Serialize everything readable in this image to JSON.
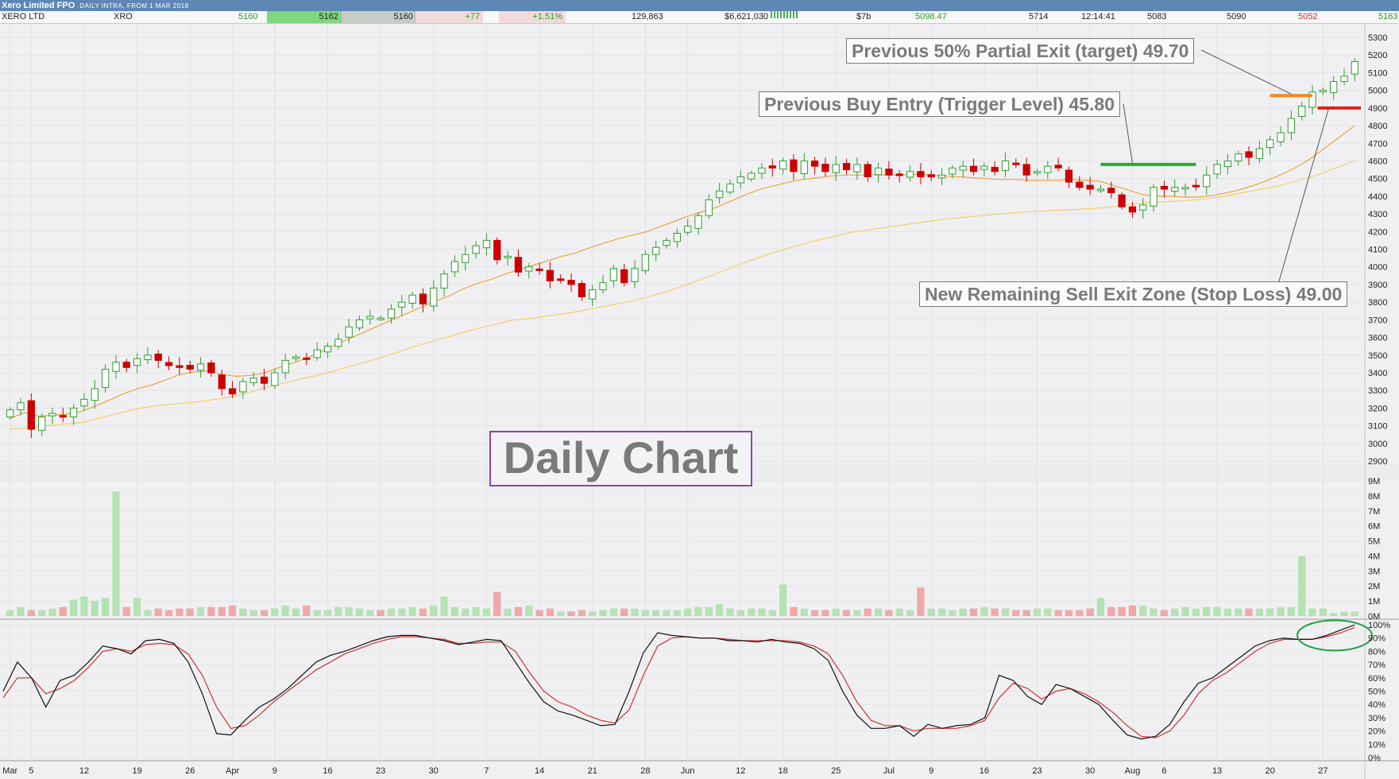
{
  "header": {
    "name": "Xero Limited FPO",
    "subtitle": "DAILY INTRA, FROM 1 MAR 2018"
  },
  "quote": {
    "company": "XERO LTD",
    "code": "XRO",
    "last": "5160",
    "bid": "5162",
    "ask": "5160",
    "change": "+77",
    "change_pct": "+1.51%",
    "volume": "129,863",
    "value": "$6,621,030",
    "mcap": "$7b",
    "vwap": "5098.47",
    "high52": "5714",
    "time": "12:14:41",
    "open": "5083",
    "high": "5090",
    "low": "5052",
    "close": "5163"
  },
  "annotations": {
    "target": "Previous 50% Partial Exit (target) 49.70",
    "entry": "Previous Buy Entry (Trigger Level) 45.80",
    "stop": "New Remaining Sell Exit Zone (Stop Loss) 49.00",
    "watermark": "Daily Chart"
  },
  "colors": {
    "up": "#2f9e2f",
    "down": "#cc0000",
    "ma_fast": "#e8a640",
    "ma_slow": "#f3cf6c",
    "vol_up": "#b5e2b5",
    "vol_down": "#f0a8a8",
    "entry_line": "#2aa832",
    "target_line": "#f08a24",
    "stop_line": "#e02020",
    "stoch_k": "#111111",
    "stoch_d": "#d03030",
    "ellipse": "#22a040"
  },
  "chart_data": {
    "type": "candlestick",
    "title": "Xero Limited FPO",
    "price_axis": {
      "min": 2900,
      "max": 5300,
      "ticks": [
        2900,
        3000,
        3100,
        3200,
        3300,
        3400,
        3500,
        3600,
        3700,
        3800,
        3900,
        4000,
        4100,
        4200,
        4300,
        4400,
        4500,
        4600,
        4700,
        4800,
        4900,
        5000,
        5100,
        5200,
        5300
      ]
    },
    "volume_axis": {
      "min": 0,
      "max": 9000000,
      "tick_labels": [
        "0M",
        "1M",
        "2M",
        "3M",
        "4M",
        "5M",
        "6M",
        "7M",
        "8M",
        "9M"
      ]
    },
    "stoch_axis": {
      "min": 0,
      "max": 100,
      "tick_labels": [
        "0%",
        "10%",
        "20%",
        "30%",
        "40%",
        "50%",
        "60%",
        "70%",
        "80%",
        "90%",
        "100%"
      ]
    },
    "x_labels": [
      "Mar",
      "5",
      "12",
      "19",
      "26",
      "Apr",
      "9",
      "16",
      "23",
      "30",
      "7",
      "14",
      "21",
      "28",
      "Jun",
      "12",
      "18",
      "25",
      "Jul",
      "9",
      "16",
      "23",
      "30",
      "Aug",
      "6",
      "13",
      "20",
      "27"
    ],
    "x_label_bars": [
      0,
      2,
      7,
      12,
      17,
      21,
      25,
      30,
      35,
      40,
      45,
      50,
      55,
      60,
      64,
      69,
      73,
      78,
      83,
      87,
      92,
      97,
      102,
      106,
      109,
      114,
      119,
      124
    ],
    "closes": [
      3190,
      3230,
      3080,
      3150,
      3170,
      3150,
      3200,
      3250,
      3310,
      3420,
      3460,
      3430,
      3480,
      3500,
      3470,
      3440,
      3430,
      3420,
      3450,
      3400,
      3310,
      3280,
      3350,
      3370,
      3340,
      3400,
      3470,
      3490,
      3480,
      3530,
      3550,
      3590,
      3660,
      3700,
      3720,
      3710,
      3760,
      3800,
      3840,
      3790,
      3880,
      3960,
      4030,
      4070,
      4120,
      4150,
      4040,
      4060,
      3970,
      4000,
      3980,
      3920,
      3930,
      3900,
      3830,
      3870,
      3910,
      3990,
      3910,
      3990,
      4070,
      4110,
      4150,
      4190,
      4230,
      4290,
      4380,
      4430,
      4470,
      4510,
      4530,
      4560,
      4560,
      4600,
      4540,
      4600,
      4570,
      4540,
      4580,
      4550,
      4580,
      4510,
      4560,
      4520,
      4520,
      4540,
      4510,
      4510,
      4520,
      4560,
      4570,
      4540,
      4570,
      4540,
      4600,
      4580,
      4520,
      4540,
      4570,
      4560,
      4480,
      4450,
      4440,
      4440,
      4420,
      4340,
      4310,
      4350,
      4450,
      4440,
      4450,
      4450,
      4460,
      4520,
      4580,
      4600,
      4640,
      4620,
      4670,
      4720,
      4760,
      4840,
      4910,
      4990,
      5000,
      5050,
      5080,
      5163
    ],
    "ma_fast": [
      3140,
      3175,
      3155,
      3160,
      3165,
      3180,
      3210,
      3245,
      3280,
      3310,
      3330,
      3360,
      3390,
      3405,
      3410,
      3390,
      3380,
      3385,
      3400,
      3430,
      3455,
      3485,
      3520,
      3560,
      3595,
      3630,
      3665,
      3700,
      3735,
      3770,
      3805,
      3835,
      3875,
      3905,
      3930,
      3960,
      3985,
      4010,
      4035,
      4060,
      4080,
      4110,
      4135,
      4160,
      4180,
      4200,
      4230,
      4260,
      4290,
      4315,
      4340,
      4375,
      4410,
      4440,
      4460,
      4480,
      4495,
      4505,
      4515,
      4520,
      4520,
      4520,
      4520,
      4520,
      4525,
      4520,
      4515,
      4510,
      4505,
      4500,
      4495,
      4495,
      4490,
      4490,
      4490,
      4495,
      4490,
      4485,
      4460,
      4435,
      4410,
      4400,
      4400,
      4395,
      4395,
      4405,
      4420,
      4440,
      4465,
      4495,
      4530,
      4570,
      4620,
      4680,
      4740,
      4800
    ],
    "ma_slow": [
      3080,
      3090,
      3100,
      3110,
      3120,
      3150,
      3175,
      3200,
      3215,
      3225,
      3235,
      3250,
      3265,
      3295,
      3325,
      3350,
      3375,
      3400,
      3430,
      3460,
      3490,
      3525,
      3560,
      3590,
      3620,
      3650,
      3675,
      3700,
      3710,
      3725,
      3740,
      3760,
      3780,
      3800,
      3825,
      3855,
      3890,
      3930,
      3970,
      4010,
      4050,
      4085,
      4115,
      4145,
      4170,
      4195,
      4210,
      4225,
      4240,
      4255,
      4270,
      4280,
      4290,
      4300,
      4310,
      4315,
      4320,
      4325,
      4330,
      4340,
      4355,
      4365,
      4370,
      4375,
      4385,
      4400,
      4420,
      4440,
      4460,
      4490,
      4520,
      4560,
      4600
    ],
    "volume": [
      0.4,
      0.6,
      0.4,
      0.4,
      0.5,
      0.6,
      1.1,
      1.3,
      1.0,
      1.2,
      8.3,
      0.6,
      1.2,
      0.4,
      0.5,
      0.4,
      0.5,
      0.5,
      0.6,
      0.6,
      0.6,
      0.7,
      0.5,
      0.4,
      0.4,
      0.5,
      0.7,
      0.5,
      0.7,
      0.4,
      0.4,
      0.6,
      0.6,
      0.5,
      0.4,
      0.4,
      0.5,
      0.5,
      0.6,
      0.5,
      0.7,
      1.3,
      0.6,
      0.5,
      0.6,
      0.5,
      1.6,
      0.5,
      0.6,
      0.7,
      0.4,
      0.5,
      0.3,
      0.3,
      0.4,
      0.3,
      0.4,
      0.5,
      0.5,
      0.5,
      0.4,
      0.4,
      0.4,
      0.4,
      0.5,
      0.6,
      0.6,
      0.8,
      0.5,
      0.4,
      0.5,
      0.5,
      0.4,
      2.1,
      0.6,
      0.5,
      0.4,
      0.4,
      0.5,
      0.4,
      0.4,
      0.5,
      0.5,
      0.4,
      0.5,
      0.4,
      1.9,
      0.5,
      0.5,
      0.4,
      0.5,
      0.5,
      0.6,
      0.5,
      0.5,
      0.4,
      0.4,
      0.5,
      0.5,
      0.4,
      0.4,
      0.4,
      0.5,
      1.2,
      0.6,
      0.6,
      0.7,
      0.7,
      0.5,
      0.4,
      0.5,
      0.6,
      0.5,
      0.6,
      0.6,
      0.5,
      0.5,
      0.5,
      0.5,
      0.5,
      0.6,
      0.6,
      4.0,
      0.5,
      0.5,
      0.2
    ],
    "stoch_k": [
      50,
      72,
      60,
      38,
      58,
      62,
      72,
      84,
      82,
      78,
      88,
      89,
      86,
      72,
      48,
      18,
      17,
      28,
      38,
      44,
      52,
      62,
      72,
      77,
      80,
      84,
      88,
      91,
      92,
      92,
      90,
      88,
      85,
      87,
      89,
      88,
      72,
      56,
      42,
      35,
      32,
      28,
      24,
      25,
      50,
      79,
      94,
      92,
      91,
      90,
      90,
      88,
      88,
      87,
      89,
      87,
      86,
      82,
      73,
      50,
      32,
      22,
      22,
      24,
      16,
      25,
      22,
      24,
      25,
      30,
      62,
      58,
      46,
      40,
      55,
      52,
      46,
      40,
      28,
      17,
      14,
      16,
      25,
      42,
      56,
      60,
      68,
      76,
      84,
      88,
      90,
      89,
      89,
      92,
      96,
      100
    ],
    "stoch_d": [
      45,
      60,
      60,
      48,
      52,
      58,
      68,
      80,
      82,
      80,
      85,
      86,
      85,
      78,
      62,
      38,
      22,
      24,
      32,
      42,
      50,
      58,
      66,
      72,
      78,
      82,
      86,
      89,
      91,
      91,
      90,
      89,
      86,
      86,
      87,
      87,
      80,
      64,
      50,
      42,
      38,
      32,
      28,
      26,
      36,
      62,
      84,
      90,
      91,
      90,
      90,
      89,
      88,
      88,
      88,
      88,
      87,
      84,
      78,
      62,
      42,
      28,
      24,
      24,
      20,
      22,
      22,
      22,
      24,
      28,
      45,
      56,
      52,
      44,
      50,
      52,
      48,
      42,
      34,
      24,
      16,
      15,
      20,
      32,
      48,
      58,
      64,
      72,
      80,
      86,
      89,
      89,
      89,
      91,
      94,
      98
    ],
    "levels": {
      "entry": 4580,
      "target": 4970,
      "stop": 4900
    }
  }
}
